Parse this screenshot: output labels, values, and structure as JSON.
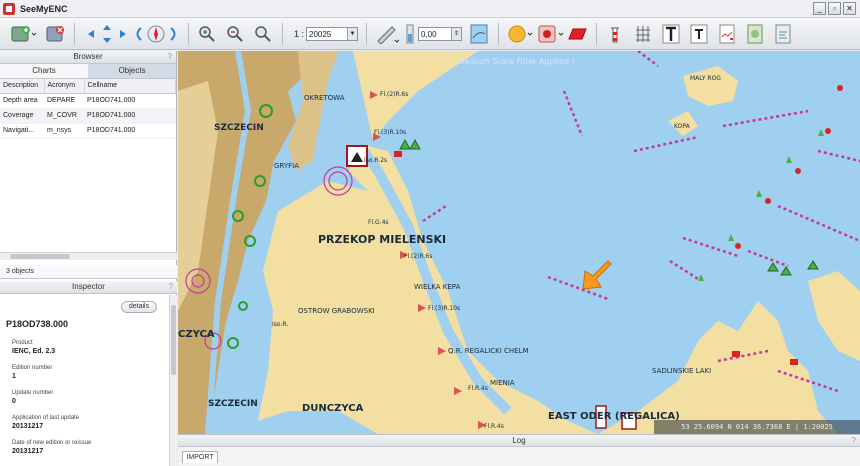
{
  "app": {
    "title": "SeeMyENC"
  },
  "window": {
    "minimize": "_",
    "maximize": "▫",
    "close": "✕"
  },
  "toolbar": {
    "scale_prefix": "1 :",
    "scale_value": "20025",
    "offset_value": "0,00"
  },
  "browser": {
    "title": "Browser",
    "help": "?",
    "tabs": [
      {
        "label": "Charts",
        "active": false
      },
      {
        "label": "Objects",
        "active": true
      }
    ],
    "columns": [
      "Description",
      "Acronym",
      "Cellname"
    ],
    "rows": [
      {
        "description": "Depth area",
        "acronym": "DEPARE",
        "cellname": "P18OD741.000"
      },
      {
        "description": "Coverage",
        "acronym": "M_COVR",
        "cellname": "P18OD741.000"
      },
      {
        "description": "Navigati...",
        "acronym": "m_nsys",
        "cellname": "P18OD741.000"
      }
    ],
    "count": "3 objects"
  },
  "inspector": {
    "title": "Inspector",
    "help": "?",
    "details_button": "details",
    "cell_name": "P18OD738.000",
    "fields": [
      {
        "key": "Product",
        "value": "IENC, Ed. 2.3"
      },
      {
        "key": "Edition number",
        "value": "1"
      },
      {
        "key": "Update number",
        "value": "0"
      },
      {
        "key": "Application of last update",
        "value": "20131217"
      },
      {
        "key": "Date of new edition or reissue",
        "value": "20131217"
      }
    ]
  },
  "map": {
    "scale_banner": "Medium Scale Filter Applied !",
    "labels": {
      "przekop": "PRZEKOP MIELENSKI",
      "szczecin_top": "SZCZECIN",
      "szczecin_bottom": "SZCZECIN",
      "dunczyca": "DUNCZYCA",
      "czyca": "CZYCA",
      "east_oder": "EAST ODER (REGALICA)",
      "maly_rog": "MALY ROG",
      "kopa": "KOPA",
      "wielka_kepa": "WIELKA KEPA",
      "mienia": "MIENIA",
      "ostrow": "OSTROW GRABOWSKI",
      "sadlinskie": "SADLINSKIE LAKI",
      "okretowa": "OKRETOWA",
      "gryfia": "GRYFIA",
      "regalicki": "Q.R. REGALICKI CHELM",
      "light1": "Fl.(2)R.6s",
      "light2": "Fl.(3)R.10s",
      "light3": "Fl.G.4s",
      "light4": "Fl.(2)R.6s",
      "light5": "Fl.(3)R.10s",
      "light6": "Iso.R.2s",
      "light7": "Fl.R.4s",
      "light8": "Iso.R.",
      "light9": "Fl.R.4s"
    },
    "coordinates": "53 25.6094 N   014 36.7368 E | 1:20025",
    "colors": {
      "water": "#9fd0f0",
      "land": "#f2dfa1",
      "urban": "#c9a96b",
      "magenta": "#c3399b"
    }
  },
  "log": {
    "title": "Log",
    "help": "?",
    "tab": "IMPORT"
  }
}
